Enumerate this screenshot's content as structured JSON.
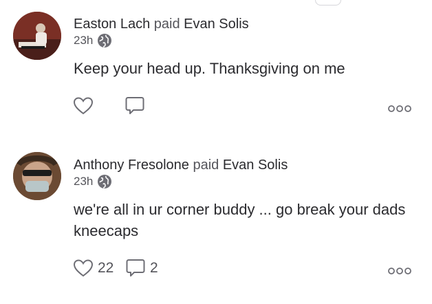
{
  "feed": [
    {
      "sender": "Easton Lach",
      "verb": "paid",
      "recipient": "Evan Solis",
      "time": "23h",
      "visibility_icon": "globe-icon",
      "message": "Keep your head up. Thanksgiving on me",
      "like_count": "",
      "comment_count": ""
    },
    {
      "sender": "Anthony Fresolone",
      "verb": "paid",
      "recipient": "Evan Solis",
      "time": "23h",
      "visibility_icon": "globe-icon",
      "message": "we're all in ur corner buddy ... go break your dads kneecaps",
      "like_count": "22",
      "comment_count": "2"
    }
  ],
  "colors": {
    "text_primary": "#2b2b2f",
    "text_secondary": "#54545a",
    "icon_stroke": "#6e6e75"
  }
}
